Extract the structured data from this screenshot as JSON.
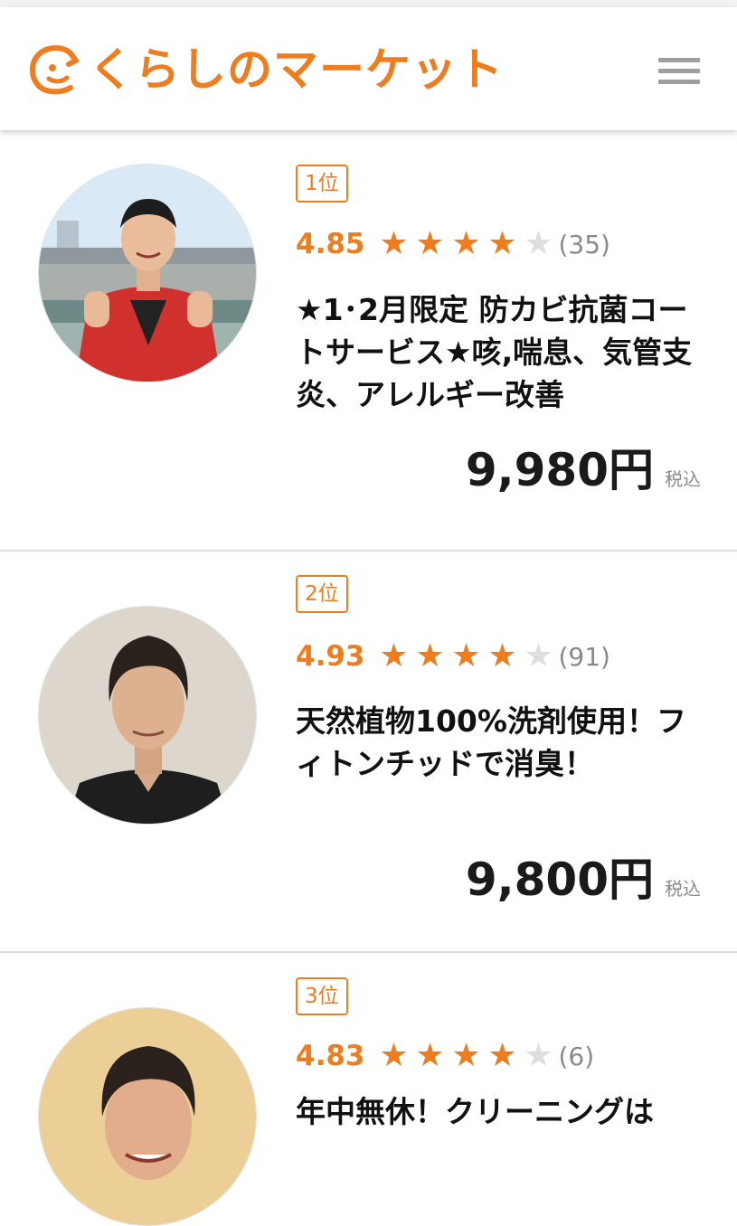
{
  "header": {
    "logo_text": "くらしのマーケット",
    "brand_color": "#ED7D1F",
    "menu_icon": "hamburger-menu-icon"
  },
  "listings": [
    {
      "rank": "1位",
      "score": "4.85",
      "stars": 4,
      "max_stars": 5,
      "reviews": "(35)",
      "title": "★1･2月限定 防カビ抗菌コートサービス★咳,喘息、気管支炎、アレルギー改善",
      "price": "9,980円",
      "tax": "税込"
    },
    {
      "rank": "2位",
      "score": "4.93",
      "stars": 4,
      "max_stars": 5,
      "reviews": "(91)",
      "title": "天然植物100%洗剤使用！フィトンチッドで消臭！",
      "price": "9,800円",
      "tax": "税込"
    },
    {
      "rank": "3位",
      "score": "4.83",
      "stars": 4,
      "max_stars": 5,
      "reviews": "(6)",
      "title": "年中無休！クリーニングは",
      "price": "",
      "tax": ""
    }
  ]
}
